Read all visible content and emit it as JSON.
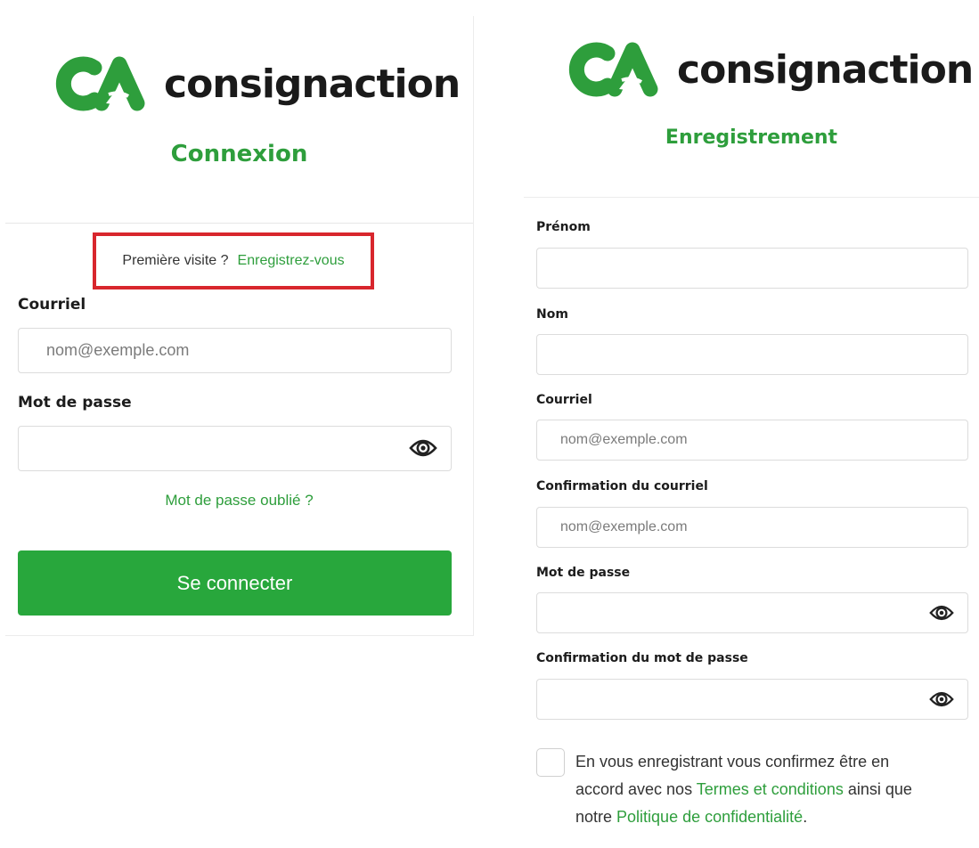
{
  "brand": {
    "name": "consignaction",
    "logo_icon": "ca-recycle-logo",
    "color_green": "#2e9e3c",
    "color_button": "#28a73c",
    "color_highlight": "#d8262d"
  },
  "login": {
    "title": "Connexion",
    "signup_prompt": "Première visite ?",
    "signup_link": "Enregistrez-vous",
    "email_label": "Courriel",
    "email_placeholder": "nom@exemple.com",
    "password_label": "Mot de passe",
    "password_toggle_icon": "eye-icon",
    "forgot_link": "Mot de passe oublié ?",
    "submit_label": "Se connecter"
  },
  "register": {
    "title": "Enregistrement",
    "first_name_label": "Prénom",
    "last_name_label": "Nom",
    "email_label": "Courriel",
    "email_placeholder": "nom@exemple.com",
    "email_confirm_label": "Confirmation du courriel",
    "email_confirm_placeholder": "nom@exemple.com",
    "password_label": "Mot de passe",
    "password_confirm_label": "Confirmation du mot de passe",
    "terms_prefix": "En vous enregistrant vous confirmez être en accord avec nos ",
    "terms_link": "Termes et conditions",
    "terms_middle": " ainsi que notre ",
    "privacy_link": "Politique de confidentialité",
    "terms_suffix": "."
  }
}
